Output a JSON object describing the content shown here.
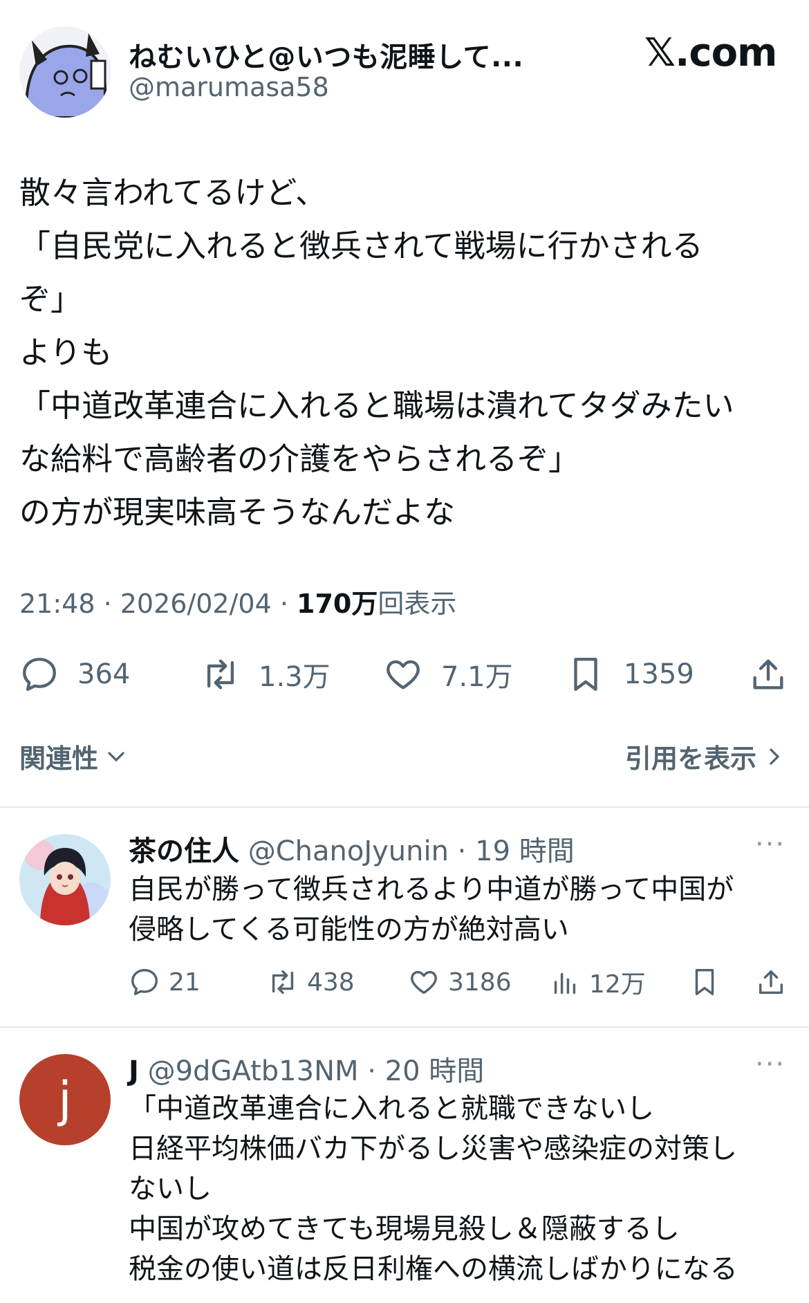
{
  "tweet": {
    "display_name": "ねむいひと@いつも泥睡して...",
    "handle": "@marumasa58",
    "brand": "𝕏.com",
    "body": "散々言われてるけど、\n「自民党に入れると徴兵されて戦場に行かされる\nぞ」\nよりも\n「中道改革連合に入れると職場は潰れてタダみたい\nな給料で高齢者の介護をやらされるぞ」\nの方が現実味高そうなんだよな",
    "time": "21:48 · 2026/02/04 · ",
    "views_count": "170万",
    "views_label": "回表示",
    "stats": {
      "replies": "364",
      "reposts": "1.3万",
      "likes": "7.1万",
      "bookmarks": "1359"
    },
    "sort_label": "関連性",
    "quotes_label": "引用を表示"
  },
  "replies": [
    {
      "display_name": "茶の住人",
      "handle_time": " @ChanoJyunin · 19 時間",
      "more": "···",
      "text": "自民が勝って徴兵されるより中道が勝って中国が\n侵略してくる可能性の方が絶対高い",
      "stats": {
        "replies": "21",
        "reposts": "438",
        "likes": "3186",
        "views": "12万"
      }
    },
    {
      "display_name": "J",
      "avatar_letter": "j",
      "handle_time": " @9dGAtb13NM · 20 時間",
      "more": "···",
      "text": "「中道改革連合に入れると就職できないし\n日経平均株価バカ下がるし災害や感染症の対策し\nないし\n中国が攻めてきても現場見殺し＆隠蔽するし\n税金の使い道は反日利権への横流しばかりになる"
    }
  ],
  "colors": {
    "text": "#0f1419",
    "secondary": "#536471",
    "divider": "#e7e9ea",
    "reply2_avatar": "#b6402b"
  }
}
